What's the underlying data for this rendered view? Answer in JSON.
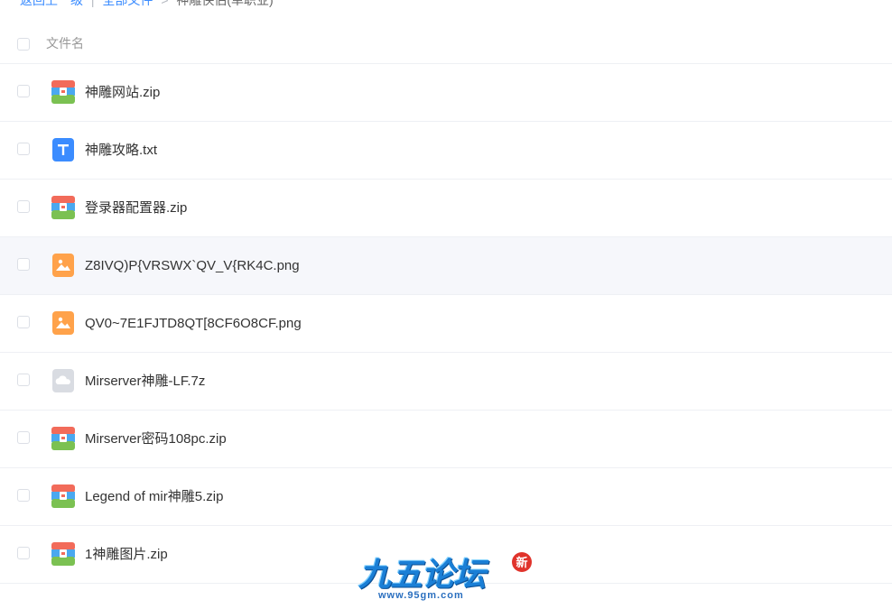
{
  "breadcrumb": {
    "back": "返回上一级",
    "separator": "|",
    "all_files": "全部文件",
    "arrow": ">",
    "current": "神雕侠侣(单职业)"
  },
  "table": {
    "header_name": "文件名"
  },
  "files": [
    {
      "name": "神雕网站.zip",
      "type": "zip"
    },
    {
      "name": "神雕攻略.txt",
      "type": "txt"
    },
    {
      "name": "登录器配置器.zip",
      "type": "zip"
    },
    {
      "name": "Z8IVQ)P{VRSWX`QV_V{RK4C.png",
      "type": "image",
      "hovered": true
    },
    {
      "name": "QV0~7E1FJTD8QT[8CF6O8CF.png",
      "type": "image"
    },
    {
      "name": "Mirserver神雕-LF.7z",
      "type": "cloud"
    },
    {
      "name": "Mirserver密码108pc.zip",
      "type": "zip"
    },
    {
      "name": "Legend of mir神雕5.zip",
      "type": "zip"
    },
    {
      "name": "1神雕图片.zip",
      "type": "zip"
    }
  ],
  "watermark": {
    "title": "九五论坛",
    "url": "www.95gm.com",
    "badge": "新"
  },
  "colors": {
    "link": "#3b8cff",
    "row_hover": "#f6f7fb",
    "divider": "#eef0f4",
    "zip_top": "#f26b5a",
    "zip_mid": "#4aa8f0",
    "zip_bottom": "#7bc152",
    "txt": "#3b8cff",
    "image": "#ffa24a",
    "cloud": "#d9dce2"
  }
}
